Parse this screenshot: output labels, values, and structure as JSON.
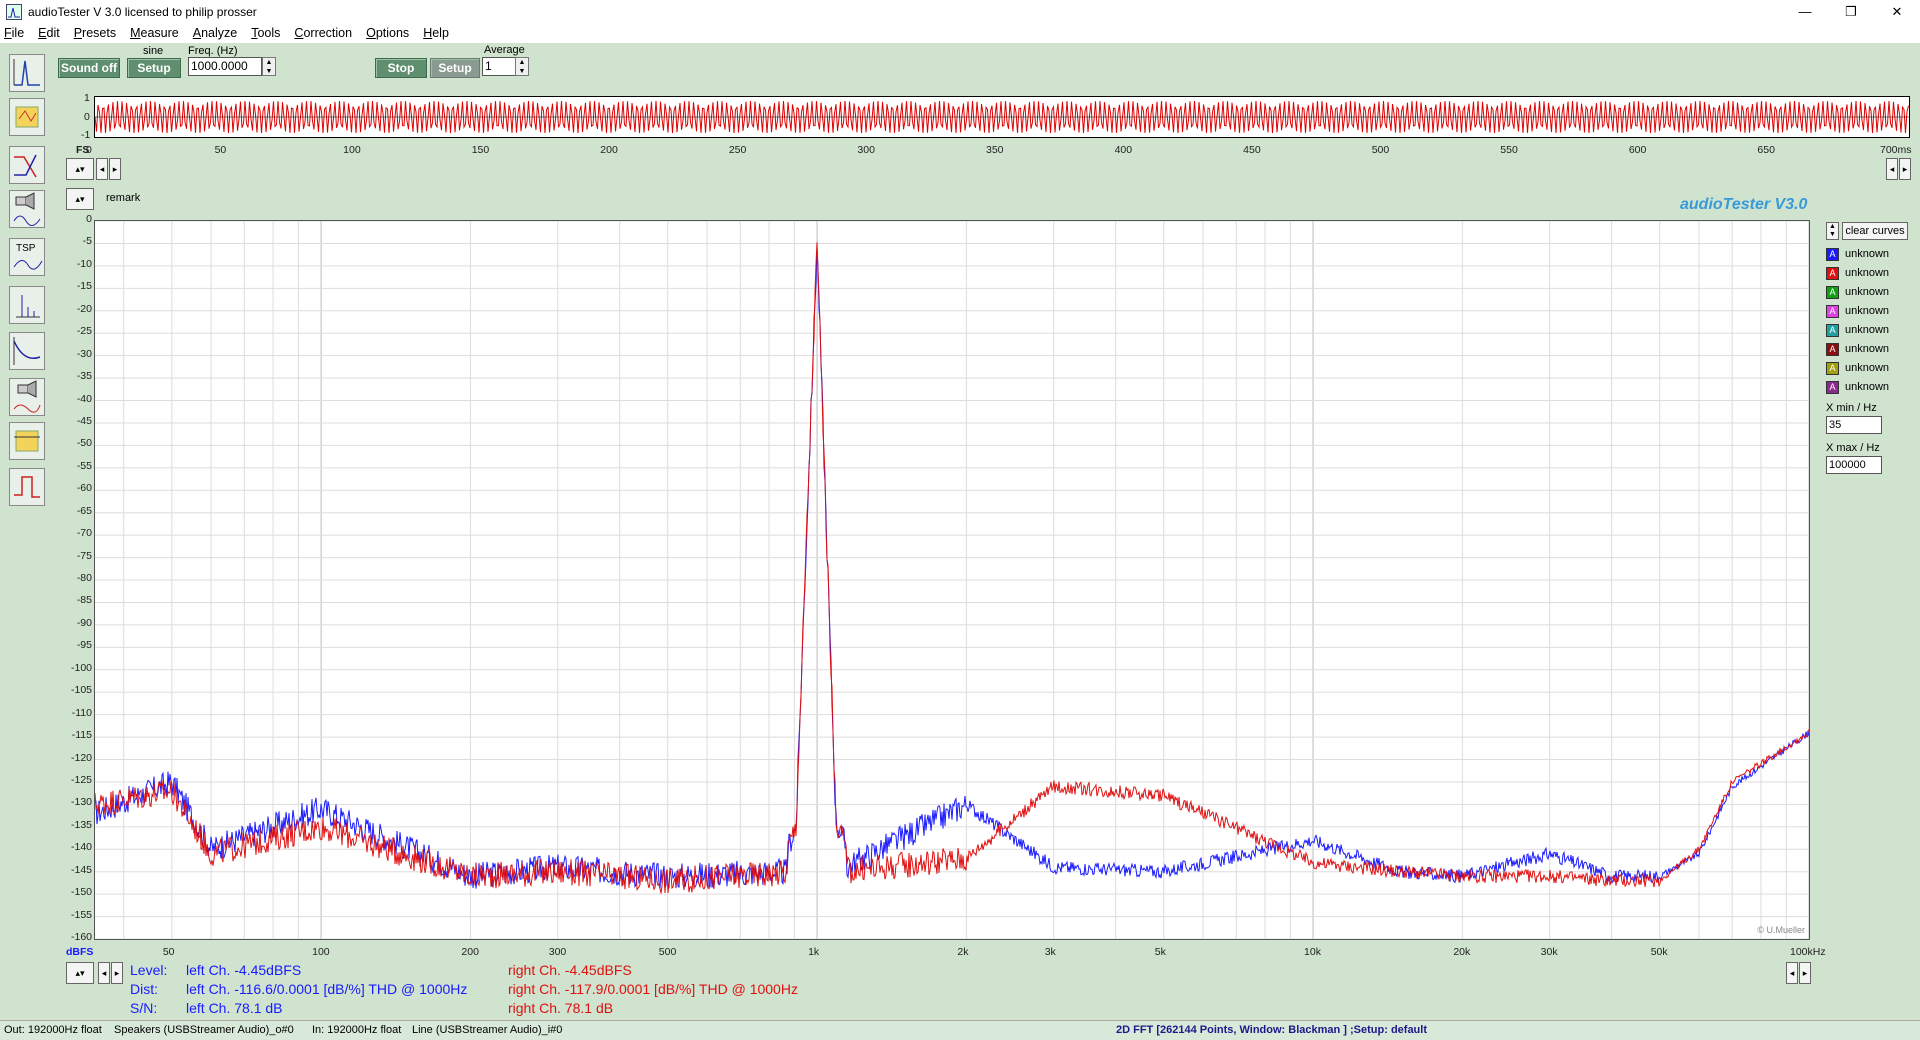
{
  "window": {
    "title": "audioTester  V 3.0   licensed to philip prosser",
    "minimize": "—",
    "maximize": "❐",
    "close": "✕"
  },
  "menu": [
    "File",
    "Edit",
    "Presets",
    "Measure",
    "Analyze",
    "Tools",
    "Correction",
    "Options",
    "Help"
  ],
  "toolbar": {
    "sound_off": "Sound off",
    "sine_label": "sine",
    "setup1": "Setup",
    "freq_label": "Freq. (Hz)",
    "freq_value": "1000.0000",
    "stop": "Stop",
    "setup2": "Setup",
    "average_label": "Average",
    "average_value": "1"
  },
  "oscilloscope": {
    "y_ticks": [
      "1",
      "0",
      "-1"
    ],
    "fs_label": "FS",
    "x_ticks": [
      "0",
      "50",
      "100",
      "150",
      "200",
      "250",
      "300",
      "350",
      "400",
      "450",
      "500",
      "550",
      "600",
      "650",
      "700ms"
    ],
    "trace_color": "#e00000"
  },
  "sidebar_icons": [
    "spectrum-icon",
    "presets-icon",
    "filter-icon",
    "speaker-icon",
    "tsp-icon",
    "fft-icon",
    "response-icon",
    "speaker-measure-icon",
    "cable-icon",
    "step-icon"
  ],
  "sidebar_tsp": "TSP",
  "plot": {
    "remark": "remark",
    "brand": "audioTester  V3.0",
    "watermark": "© U.Mueller",
    "y_unit": "dBFS",
    "y_ticks": [
      "0",
      "-5",
      "-10",
      "-15",
      "-20",
      "-25",
      "-30",
      "-35",
      "-40",
      "-45",
      "-50",
      "-55",
      "-60",
      "-65",
      "-70",
      "-75",
      "-80",
      "-85",
      "-90",
      "-95",
      "-100",
      "-105",
      "-110",
      "-115",
      "-120",
      "-125",
      "-130",
      "-135",
      "-140",
      "-145",
      "-150",
      "-155",
      "-160"
    ],
    "x_ticks": [
      "50",
      "100",
      "200",
      "300",
      "500",
      "1k",
      "2k",
      "3k",
      "5k",
      "10k",
      "20k",
      "30k",
      "50k",
      "100kHz"
    ],
    "x_tick_values": [
      50,
      100,
      200,
      300,
      500,
      1000,
      2000,
      3000,
      5000,
      10000,
      20000,
      30000,
      50000,
      100000
    ]
  },
  "legend": {
    "clear": "clear curves",
    "items": [
      {
        "label": "unknown",
        "color": "#1a1aff"
      },
      {
        "label": "unknown",
        "color": "#e01010"
      },
      {
        "label": "unknown",
        "color": "#10a010"
      },
      {
        "label": "unknown",
        "color": "#e040e0"
      },
      {
        "label": "unknown",
        "color": "#20a0a0"
      },
      {
        "label": "unknown",
        "color": "#8a1010"
      },
      {
        "label": "unknown",
        "color": "#a0a010"
      },
      {
        "label": "unknown",
        "color": "#8a2a8a"
      }
    ],
    "xmin_label": "X min / Hz",
    "xmin_value": "35",
    "xmax_label": "X max / Hz",
    "xmax_value": "100000"
  },
  "readout": {
    "level_label": "Level:",
    "dist_label": "Dist:",
    "sn_label": "S/N:",
    "left_level": "left Ch. -4.45dBFS",
    "left_dist": "left Ch. -116.6/0.0001 [dB/%] THD @ 1000Hz",
    "left_sn": "left Ch. 78.1 dB",
    "right_level": "right Ch. -4.45dBFS",
    "right_dist": "right Ch. -117.9/0.0001 [dB/%] THD @ 1000Hz",
    "right_sn": "right Ch. 78.1 dB"
  },
  "status": {
    "out": "Out: 192000Hz float",
    "out_dev": "Speakers (USBStreamer Audio)_o#0",
    "in": "In: 192000Hz float",
    "in_dev": "Line (USBStreamer Audio)_i#0",
    "mode": "2D FFT [262144 Points, Window: Blackman ] ;Setup:  default"
  },
  "chart_data": {
    "type": "line",
    "title": "",
    "xlabel": "",
    "ylabel": "dBFS",
    "xscale": "log",
    "xlim": [
      35,
      100000
    ],
    "ylim": [
      -160,
      0
    ],
    "grid": true,
    "series": [
      {
        "color": "#1a1aff",
        "x": [
          35,
          50,
          60,
          100,
          200,
          300,
          500,
          900,
          1000,
          1100,
          2000,
          3000,
          5000,
          10000,
          15000,
          20000,
          30000,
          40000,
          50000,
          60000,
          70000,
          100000
        ],
        "y": [
          -132,
          -125,
          -140,
          -131,
          -146,
          -144,
          -146,
          -145,
          -5,
          -145,
          -130,
          -144,
          -145,
          -138,
          -145,
          -146,
          -141,
          -146,
          -146,
          -141,
          -126,
          -114
        ]
      },
      {
        "color": "#e01010",
        "x": [
          35,
          50,
          60,
          100,
          200,
          300,
          500,
          900,
          1000,
          1100,
          2000,
          3000,
          5000,
          10000,
          15000,
          20000,
          30000,
          40000,
          50000,
          60000,
          70000,
          100000
        ],
        "y": [
          -130,
          -127,
          -141,
          -135,
          -146,
          -145,
          -147,
          -145,
          -5,
          -145,
          -142,
          -126,
          -128,
          -143,
          -145,
          -146,
          -146,
          -147,
          -147,
          -140,
          -125,
          -114
        ]
      }
    ]
  }
}
